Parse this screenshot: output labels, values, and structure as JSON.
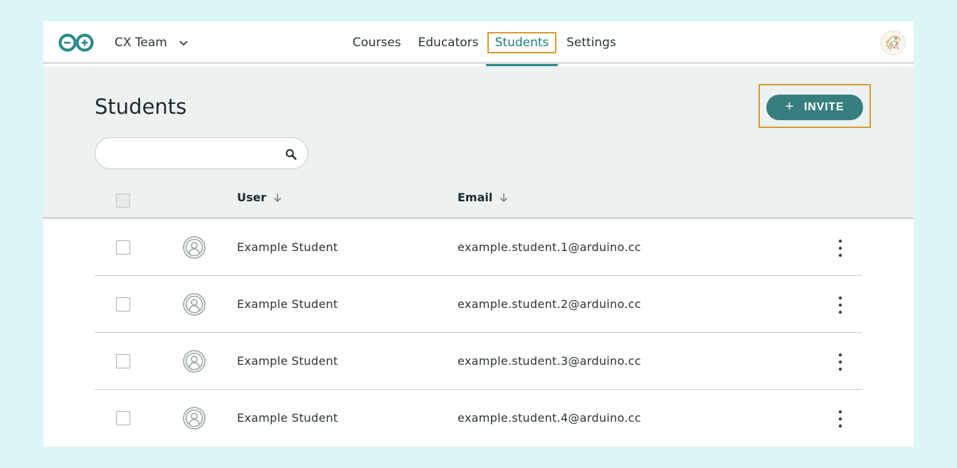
{
  "nav": {
    "team_name": "CX Team",
    "items": [
      {
        "label": "Courses"
      },
      {
        "label": "Educators"
      },
      {
        "label": "Students"
      },
      {
        "label": "Settings"
      }
    ],
    "active": "Students"
  },
  "page": {
    "title": "Students",
    "invite_label": "INVITE",
    "invite_icon": "plus-icon",
    "search_placeholder": "",
    "search_value": ""
  },
  "table": {
    "columns": [
      {
        "label": "User",
        "sort": "descending"
      },
      {
        "label": "Email",
        "sort": "descending"
      }
    ],
    "rows": [
      {
        "name": "Example Student",
        "email": "example.student.1@arduino.cc"
      },
      {
        "name": "Example Student",
        "email": "example.student.2@arduino.cc"
      },
      {
        "name": "Example Student",
        "email": "example.student.3@arduino.cc"
      },
      {
        "name": "Example Student",
        "email": "example.student.4@arduino.cc"
      }
    ]
  },
  "colors": {
    "accent": "#377f7f",
    "highlight_border": "#d59d2b",
    "page_background": "#dcf5f5",
    "band_background": "#ecf1f1"
  }
}
